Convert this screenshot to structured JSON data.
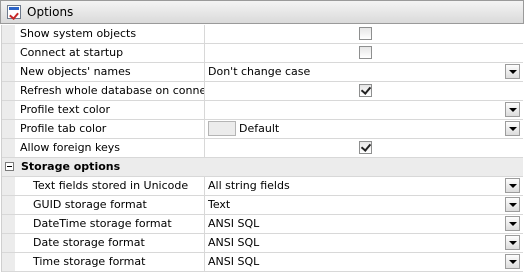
{
  "window": {
    "title": "Options",
    "title_icon": "options-checklist-icon"
  },
  "properties": [
    {
      "key": "show_system_objects",
      "label": "Show system objects",
      "type": "checkbox",
      "checked": false
    },
    {
      "key": "connect_at_startup",
      "label": "Connect at startup",
      "type": "checkbox",
      "checked": false
    },
    {
      "key": "new_objects_names",
      "label": "New objects' names",
      "type": "dropdown",
      "value": "Don't change case"
    },
    {
      "key": "refresh_whole_database",
      "label": "Refresh whole database on connect",
      "type": "checkbox",
      "checked": true
    },
    {
      "key": "profile_text_color",
      "label": "Profile text color",
      "type": "dropdown",
      "value": ""
    },
    {
      "key": "profile_tab_color",
      "label": "Profile tab color",
      "type": "color",
      "value": "Default",
      "swatch": "#ececec"
    },
    {
      "key": "allow_foreign_keys",
      "label": "Allow foreign keys",
      "type": "checkbox",
      "checked": true
    }
  ],
  "storage_group": {
    "label": "Storage options",
    "expanded": true,
    "items": [
      {
        "key": "text_fields_unicode",
        "label": "Text fields stored in Unicode",
        "type": "dropdown",
        "value": "All string fields"
      },
      {
        "key": "guid_storage_format",
        "label": "GUID storage format",
        "type": "dropdown",
        "value": "Text"
      },
      {
        "key": "datetime_storage_format",
        "label": "DateTime storage format",
        "type": "dropdown",
        "value": "ANSI SQL"
      },
      {
        "key": "date_storage_format",
        "label": "Date storage format",
        "type": "dropdown",
        "value": "ANSI SQL"
      },
      {
        "key": "time_storage_format",
        "label": "Time storage format",
        "type": "dropdown",
        "value": "ANSI SQL"
      }
    ]
  }
}
